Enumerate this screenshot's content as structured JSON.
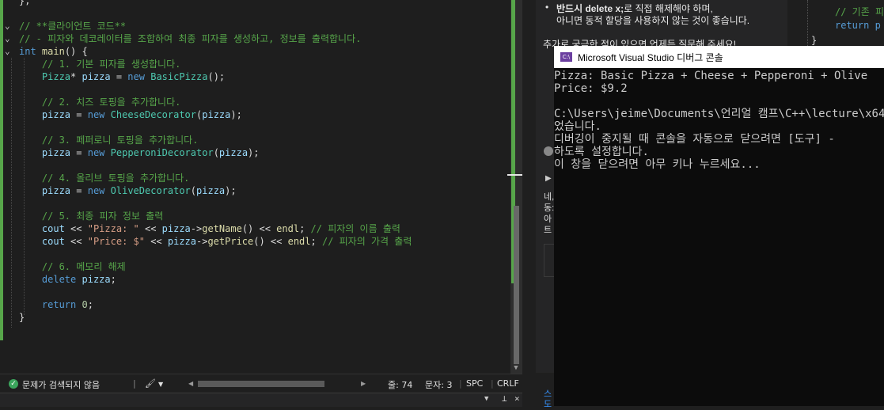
{
  "editor": {
    "lines": [
      {
        "fold": "",
        "parts": [
          [
            "pl",
            "};"
          ]
        ]
      },
      {
        "fold": "",
        "parts": []
      },
      {
        "fold": "⌄",
        "parts": [
          [
            "cm",
            "// **클라이언트 코드**"
          ]
        ]
      },
      {
        "fold": "⌄",
        "parts": [
          [
            "cm",
            "// - 피자와 데코레이터를 조합하여 최종 피자를 생성하고, 정보를 출력합니다."
          ]
        ]
      },
      {
        "fold": "⌄",
        "parts": [
          [
            "kw",
            "int"
          ],
          [
            "pl",
            " "
          ],
          [
            "fn",
            "main"
          ],
          [
            "pl",
            "() {"
          ]
        ]
      },
      {
        "fold": "",
        "parts": [
          [
            "pl",
            "    "
          ],
          [
            "cm",
            "// 1. 기본 피자를 생성합니다."
          ]
        ]
      },
      {
        "fold": "",
        "parts": [
          [
            "pl",
            "    "
          ],
          [
            "ty",
            "Pizza"
          ],
          [
            "pl",
            "* "
          ],
          [
            "vr",
            "pizza"
          ],
          [
            "pl",
            " = "
          ],
          [
            "kw",
            "new"
          ],
          [
            "pl",
            " "
          ],
          [
            "ty",
            "BasicPizza"
          ],
          [
            "pl",
            "();"
          ]
        ]
      },
      {
        "fold": "",
        "parts": []
      },
      {
        "fold": "",
        "parts": [
          [
            "pl",
            "    "
          ],
          [
            "cm",
            "// 2. 치즈 토핑을 추가합니다."
          ]
        ]
      },
      {
        "fold": "",
        "parts": [
          [
            "pl",
            "    "
          ],
          [
            "vr",
            "pizza"
          ],
          [
            "pl",
            " = "
          ],
          [
            "kw",
            "new"
          ],
          [
            "pl",
            " "
          ],
          [
            "ty",
            "CheeseDecorator"
          ],
          [
            "pl",
            "("
          ],
          [
            "vr",
            "pizza"
          ],
          [
            "pl",
            ");"
          ]
        ]
      },
      {
        "fold": "",
        "parts": []
      },
      {
        "fold": "",
        "parts": [
          [
            "pl",
            "    "
          ],
          [
            "cm",
            "// 3. 페퍼로니 토핑을 추가합니다."
          ]
        ]
      },
      {
        "fold": "",
        "parts": [
          [
            "pl",
            "    "
          ],
          [
            "vr",
            "pizza"
          ],
          [
            "pl",
            " = "
          ],
          [
            "kw",
            "new"
          ],
          [
            "pl",
            " "
          ],
          [
            "ty",
            "PepperoniDecorator"
          ],
          [
            "pl",
            "("
          ],
          [
            "vr",
            "pizza"
          ],
          [
            "pl",
            ");"
          ]
        ]
      },
      {
        "fold": "",
        "parts": []
      },
      {
        "fold": "",
        "parts": [
          [
            "pl",
            "    "
          ],
          [
            "cm",
            "// 4. 올리브 토핑을 추가합니다."
          ]
        ]
      },
      {
        "fold": "",
        "parts": [
          [
            "pl",
            "    "
          ],
          [
            "vr",
            "pizza"
          ],
          [
            "pl",
            " = "
          ],
          [
            "kw",
            "new"
          ],
          [
            "pl",
            " "
          ],
          [
            "ty",
            "OliveDecorator"
          ],
          [
            "pl",
            "("
          ],
          [
            "vr",
            "pizza"
          ],
          [
            "pl",
            ");"
          ]
        ]
      },
      {
        "fold": "",
        "parts": []
      },
      {
        "fold": "",
        "parts": [
          [
            "pl",
            "    "
          ],
          [
            "cm",
            "// 5. 최종 피자 정보 출력"
          ]
        ]
      },
      {
        "fold": "",
        "parts": [
          [
            "pl",
            "    "
          ],
          [
            "vr",
            "cout"
          ],
          [
            "pl",
            " << "
          ],
          [
            "st",
            "\"Pizza: \""
          ],
          [
            "pl",
            " << "
          ],
          [
            "vr",
            "pizza"
          ],
          [
            "pl",
            "->"
          ],
          [
            "fn",
            "getName"
          ],
          [
            "pl",
            "() << "
          ],
          [
            "fn",
            "endl"
          ],
          [
            "pl",
            "; "
          ],
          [
            "cm",
            "// 피자의 이름 출력"
          ]
        ]
      },
      {
        "fold": "",
        "parts": [
          [
            "pl",
            "    "
          ],
          [
            "vr",
            "cout"
          ],
          [
            "pl",
            " << "
          ],
          [
            "st",
            "\"Price: $\""
          ],
          [
            "pl",
            " << "
          ],
          [
            "vr",
            "pizza"
          ],
          [
            "pl",
            "->"
          ],
          [
            "fn",
            "getPrice"
          ],
          [
            "pl",
            "() << "
          ],
          [
            "fn",
            "endl"
          ],
          [
            "pl",
            "; "
          ],
          [
            "cm",
            "// 피자의 가격 출력"
          ]
        ]
      },
      {
        "fold": "",
        "parts": []
      },
      {
        "fold": "",
        "parts": [
          [
            "pl",
            "    "
          ],
          [
            "cm",
            "// 6. 메모리 해제"
          ]
        ]
      },
      {
        "fold": "",
        "parts": [
          [
            "pl",
            "    "
          ],
          [
            "kw",
            "delete"
          ],
          [
            "pl",
            " "
          ],
          [
            "vr",
            "pizza"
          ],
          [
            "pl",
            ";"
          ]
        ]
      },
      {
        "fold": "",
        "parts": []
      },
      {
        "fold": "",
        "parts": [
          [
            "pl",
            "    "
          ],
          [
            "kw",
            "return"
          ],
          [
            "pl",
            " "
          ],
          [
            "nm",
            "0"
          ],
          [
            "pl",
            ";"
          ]
        ]
      },
      {
        "fold": "",
        "parts": [
          [
            "pl",
            "}"
          ]
        ]
      }
    ]
  },
  "status": {
    "issues": "문제가 검색되지 않음",
    "line": "줄: 74",
    "char": "문자: 3",
    "spc": "SPC",
    "crlf": "CRLF"
  },
  "chat": {
    "bullet_bold": "반드시 delete x;",
    "bullet_rest": "로 직접 해제해야 하며,",
    "line2": "아니면 동적 할당을 사용하지 않는 것이 좋습니다.",
    "line3": "추가로 궁금한 점이 있으면 언제든 질문해 주세요!",
    "frag1": "네,",
    "frag2": "동:",
    "frag3": "아",
    "frag4": "트",
    "foot1": "스",
    "foot2": "도"
  },
  "code2": {
    "line1": "// 기존 피",
    "line2": "return p"
  },
  "console": {
    "title": "Microsoft Visual Studio 디버그 콘솔",
    "icon": "C:\\",
    "lines": [
      "Pizza: Basic Pizza + Cheese + Pepperoni + Olive",
      "Price: $9.2",
      "",
      "C:\\Users\\jeime\\Documents\\언리얼 캠프\\C++\\lecture\\x64",
      "었습니다.",
      "디버깅이 중지될 때 콘솔을 자동으로 닫으려면 [도구] -",
      "하도록 설정합니다.",
      "이 창을 닫으려면 아무 키나 누르세요..."
    ]
  }
}
